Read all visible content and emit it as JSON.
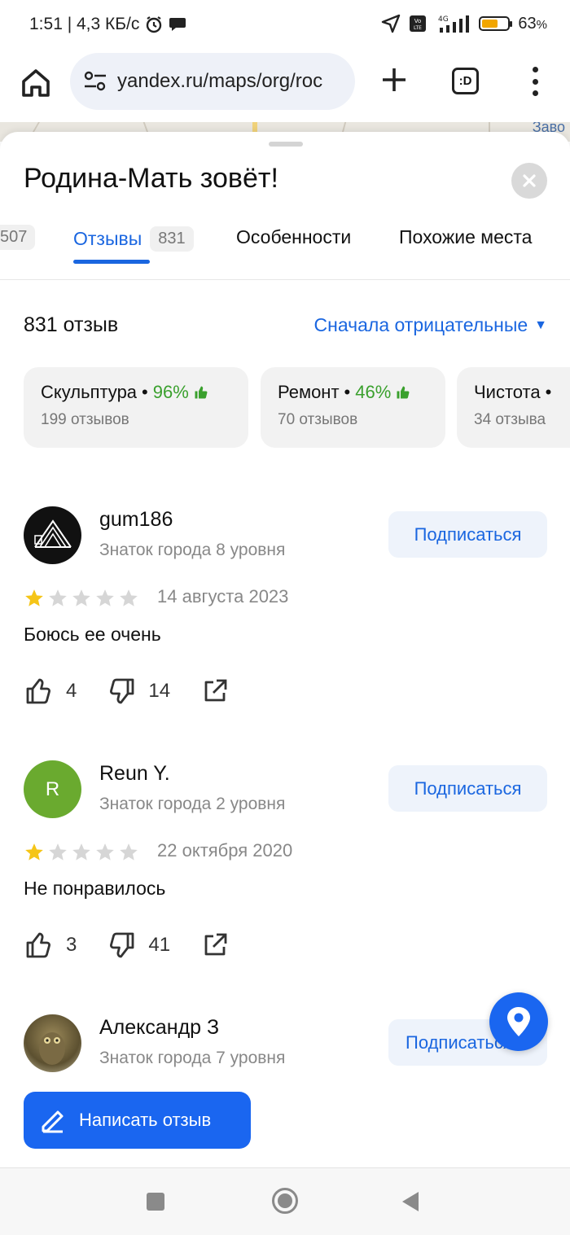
{
  "status_bar": {
    "time_speed": "1:51 | 4,3 КБ/с",
    "network": "4G",
    "volte": "Vo LTE",
    "battery_percent": "63",
    "battery_level": 0.63
  },
  "browser": {
    "url": "yandex.ru/maps/org/roc",
    "tabs_label": ":D"
  },
  "map_strip": {
    "label": "Заво"
  },
  "place": {
    "title": "Родина-Мать зовёт!",
    "tabs": [
      {
        "label": "",
        "count": "507"
      },
      {
        "label": "Отзывы",
        "count": "831",
        "active": true
      },
      {
        "label": "Особенности"
      },
      {
        "label": "Похожие места"
      }
    ]
  },
  "reviews_header": {
    "count_label": "831 отзыв",
    "sort_label": "Сначала отрицательные"
  },
  "aspects": [
    {
      "name": "Скульптура",
      "percent": "96%",
      "reviews": "199 отзывов"
    },
    {
      "name": "Ремонт",
      "percent": "46%",
      "reviews": "70 отзывов"
    },
    {
      "name": "Чистота",
      "percent": "",
      "reviews": "34 отзыва"
    }
  ],
  "reviews": [
    {
      "author": "gum186",
      "level": "Знаток города 8 уровня",
      "subscribe": "Подписаться",
      "rating": 1,
      "date": "14 августа 2023",
      "text": "Боюсь ее очень",
      "likes": "4",
      "dislikes": "14",
      "avatar_letter": ""
    },
    {
      "author": "Reun Y.",
      "level": "Знаток города 2 уровня",
      "subscribe": "Подписаться",
      "rating": 1,
      "date": "22 октября 2020",
      "text": "Не понравилось",
      "likes": "3",
      "dislikes": "41",
      "avatar_letter": "R"
    },
    {
      "author": "Александр З",
      "level": "Знаток города 7 уровня",
      "subscribe": "Подписаться"
    }
  ],
  "write_review": {
    "label": "Написать отзыв"
  },
  "colors": {
    "accent": "#1a66e0",
    "button_blue": "#1a66f0",
    "positive": "#3aa02d",
    "star_filled": "#f5c518",
    "star_empty": "#d6d6d6"
  },
  "icons": [
    "home-icon",
    "site-settings-icon",
    "plus-icon",
    "tabs-icon",
    "more-icon",
    "close-icon",
    "thumb-up-icon",
    "thumb-down-icon",
    "share-icon",
    "pencil-icon",
    "geo-pin-icon"
  ]
}
